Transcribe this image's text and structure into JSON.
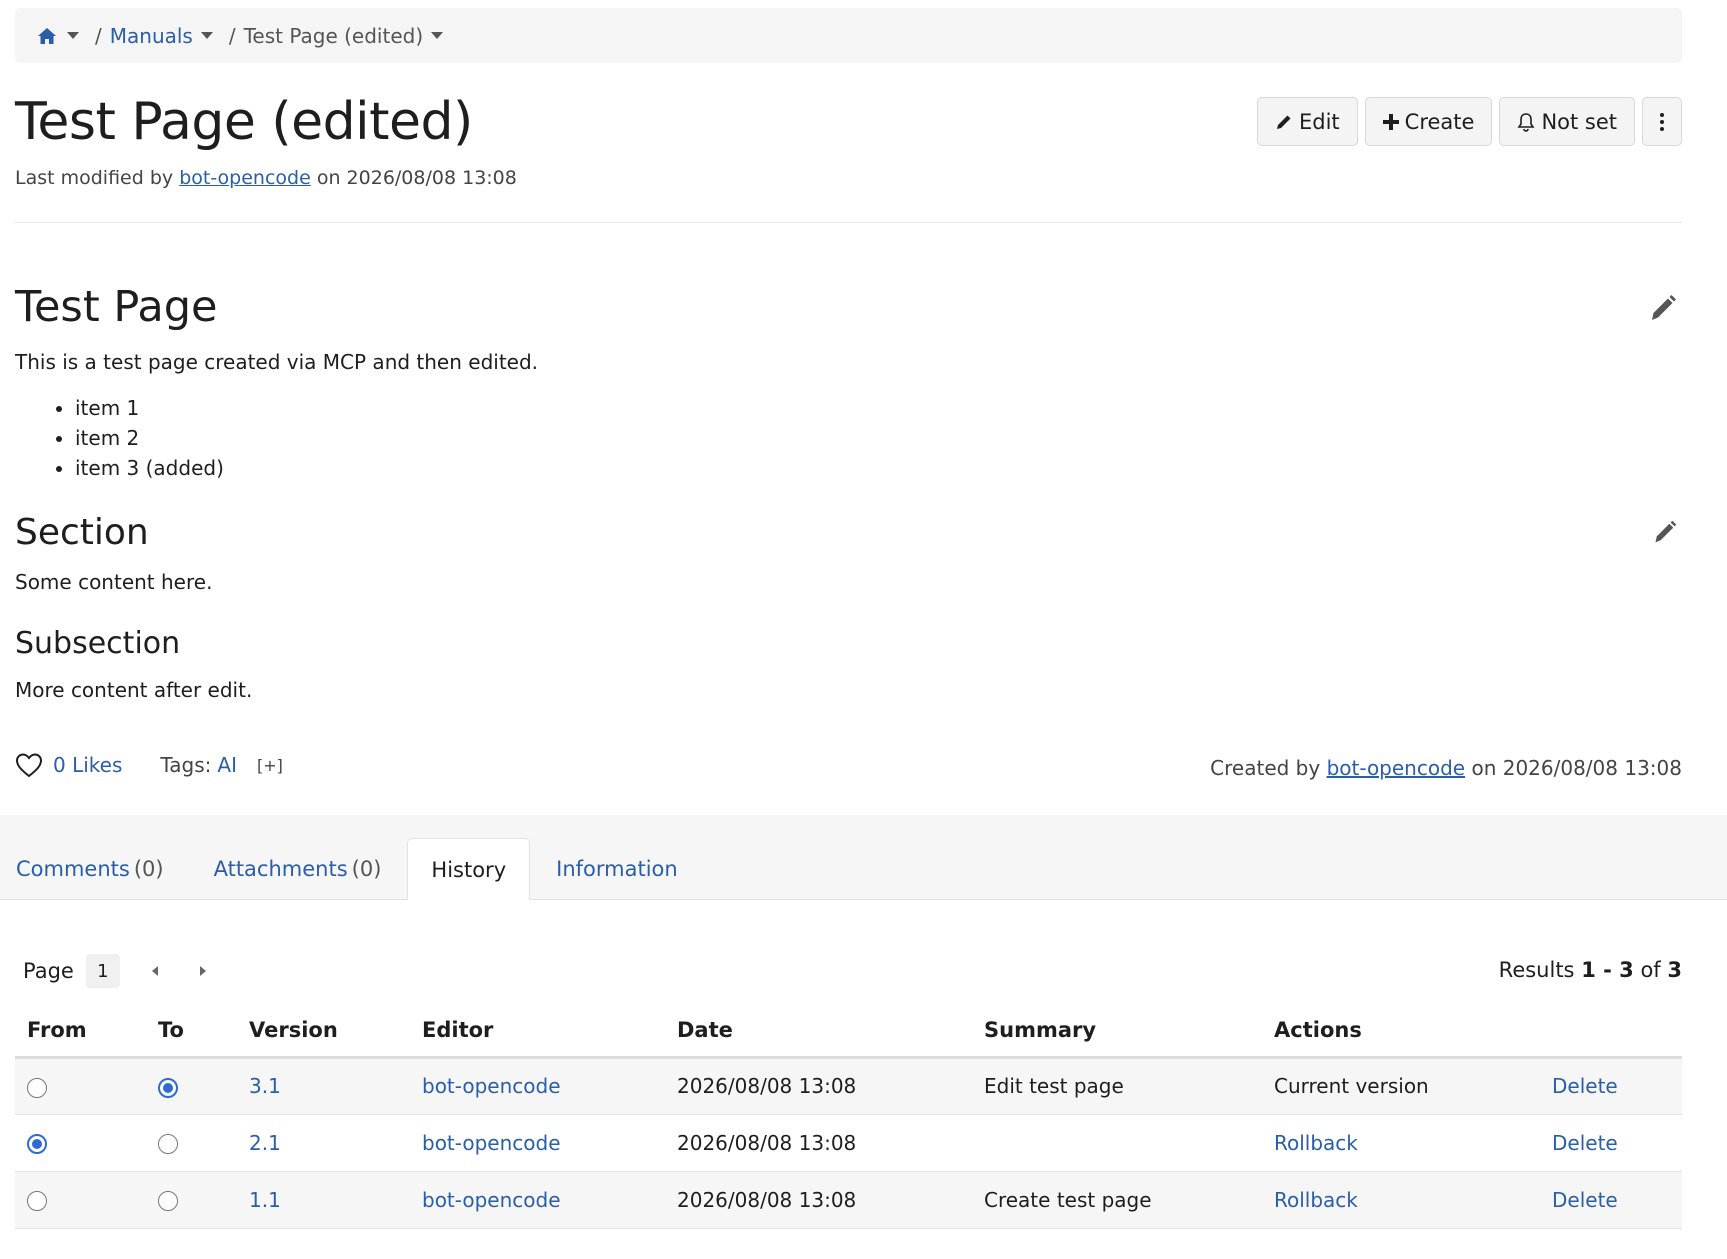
{
  "breadcrumb": {
    "items": [
      {
        "label": "Manuals"
      },
      {
        "label": "Test Page (edited)"
      }
    ]
  },
  "page": {
    "title": "Test Page (edited)",
    "meta_prefix": "Last modified by",
    "meta_user": "bot-opencode",
    "meta_suffix": "on 2026/08/08 13:08"
  },
  "toolbar": {
    "edit_label": "Edit",
    "create_label": "Create",
    "watch_label": "Not set"
  },
  "content": {
    "heading1": "Test Page",
    "paragraph1": "This is a test page created via MCP and then edited.",
    "list": [
      "item 1",
      "item 2",
      "item 3 (added)"
    ],
    "heading2": "Section",
    "paragraph2": "Some content here.",
    "heading3": "Subsection",
    "paragraph3": "More content after edit."
  },
  "footer": {
    "likes": "0 Likes",
    "tags_label": "Tags:",
    "tag": "AI",
    "tag_add": "[+]",
    "created_prefix": "Created by",
    "created_user": "bot-opencode",
    "created_suffix": "on 2026/08/08 13:08"
  },
  "tabs": [
    {
      "label": "Comments",
      "count": "(0)"
    },
    {
      "label": "Attachments",
      "count": "(0)"
    },
    {
      "label": "History",
      "count": ""
    },
    {
      "label": "Information",
      "count": ""
    }
  ],
  "pager": {
    "label": "Page",
    "current": "1",
    "results_prefix": "Results",
    "results_range": "1 - 3",
    "results_of": "of",
    "results_total": "3"
  },
  "history": {
    "columns": [
      "From",
      "To",
      "Version",
      "Editor",
      "Date",
      "Summary",
      "Actions",
      ""
    ],
    "rows": [
      {
        "from": false,
        "to": true,
        "version": "3.1",
        "editor": "bot-opencode",
        "date": "2026/08/08 13:08",
        "summary": "Edit test page",
        "action": "Current version",
        "action_link": false,
        "delete": "Delete"
      },
      {
        "from": true,
        "to": false,
        "version": "2.1",
        "editor": "bot-opencode",
        "date": "2026/08/08 13:08",
        "summary": "",
        "action": "Rollback",
        "action_link": true,
        "delete": "Delete"
      },
      {
        "from": false,
        "to": false,
        "version": "1.1",
        "editor": "bot-opencode",
        "date": "2026/08/08 13:08",
        "summary": "Create test page",
        "action": "Rollback",
        "action_link": true,
        "delete": "Delete"
      }
    ]
  },
  "colors": {
    "link": "#2b5ea8",
    "radio_checked": "#2e6bd6"
  }
}
